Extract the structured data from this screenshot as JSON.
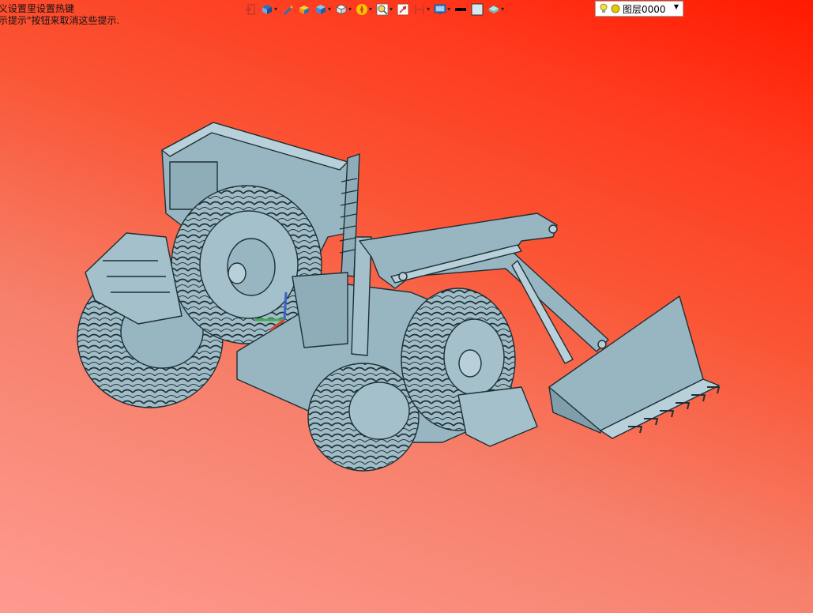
{
  "hint": {
    "line1": "义设置里设置热键",
    "line2": "示提示\"按钮来取消这些提示."
  },
  "toolbar": {
    "items": [
      {
        "icon": "exit-icon",
        "dropdown": false
      },
      {
        "icon": "select-filter-icon",
        "dropdown": true
      },
      {
        "icon": "pen-icon",
        "dropdown": false
      },
      {
        "icon": "shaded-box-icon",
        "dropdown": false
      },
      {
        "icon": "render-mode-icon",
        "dropdown": true
      },
      {
        "icon": "view-cube-icon",
        "dropdown": true
      },
      {
        "icon": "orient-icon",
        "dropdown": true
      },
      {
        "icon": "zoom-view-icon",
        "dropdown": true
      },
      {
        "icon": "section-icon",
        "dropdown": false
      },
      {
        "icon": "clip-icon",
        "dropdown": true
      },
      {
        "icon": "display-icon",
        "dropdown": true
      },
      {
        "icon": "line-color-icon",
        "dropdown": false
      },
      {
        "icon": "face-color-icon",
        "dropdown": false
      },
      {
        "icon": "material-icon",
        "dropdown": true
      }
    ]
  },
  "layer": {
    "name": "图层0000",
    "bulb_color": "#f2e24a",
    "sun_color": "#e6c800"
  },
  "colors": {
    "model_fill": "#98b6c2",
    "model_edge": "#1e2f36",
    "bg_top": "#ff1a00",
    "bg_bottom": "#ff9a90"
  }
}
